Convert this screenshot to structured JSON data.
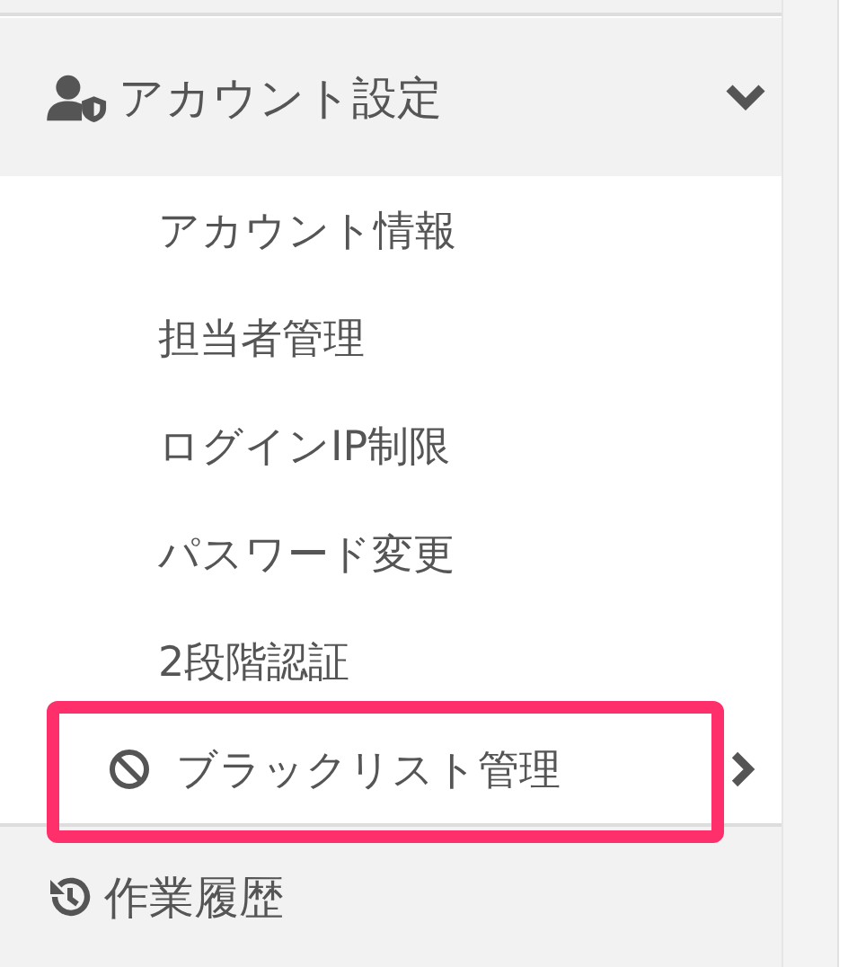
{
  "sidebar": {
    "section": {
      "label": "アカウント設定",
      "expanded": true,
      "items": [
        {
          "label": "アカウント情報",
          "kind": "plain",
          "selected": false,
          "highlighted": false
        },
        {
          "label": "担当者管理",
          "kind": "plain",
          "selected": false,
          "highlighted": false
        },
        {
          "label": "ログインIP制限",
          "kind": "plain",
          "selected": false,
          "highlighted": false
        },
        {
          "label": "パスワード変更",
          "kind": "plain",
          "selected": false,
          "highlighted": false
        },
        {
          "label": "2段階認証",
          "kind": "plain",
          "selected": false,
          "highlighted": false
        },
        {
          "label": "ブラックリスト管理",
          "kind": "ban",
          "selected": true,
          "highlighted": true
        }
      ]
    },
    "next": {
      "label": "作業履歴"
    }
  }
}
